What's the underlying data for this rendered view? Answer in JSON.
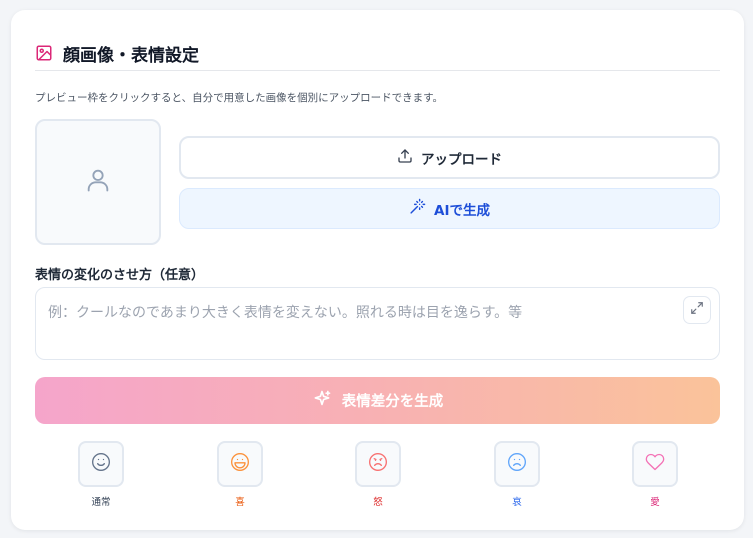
{
  "section": {
    "title": "顔画像・表情設定",
    "description": "プレビュー枠をクリックすると、自分で用意した画像を個別にアップロードできます。"
  },
  "buttons": {
    "upload_label": "アップロード",
    "ai_label": "AIで生成"
  },
  "expression_input": {
    "label": "表情の変化のさせ方（任意）",
    "placeholder": "例：クールなのであまり大きく表情を変えない。照れる時は目を逸らす。等"
  },
  "generate_button": {
    "label": "表情差分を生成"
  },
  "emotions": [
    {
      "label": "通常",
      "icon": "smile-icon",
      "color": "#334155"
    },
    {
      "label": "喜",
      "icon": "laugh-icon",
      "color": "#ea580c"
    },
    {
      "label": "怒",
      "icon": "angry-icon",
      "color": "#dc2626"
    },
    {
      "label": "哀",
      "icon": "frown-icon",
      "color": "#2563eb"
    },
    {
      "label": "愛",
      "icon": "heart-icon",
      "color": "#db2777"
    }
  ],
  "colors": {
    "title_icon": "#db2777",
    "ai_text": "#1d4ed8",
    "gradient_start": "#f5a5cb",
    "gradient_end": "#fac39a"
  }
}
